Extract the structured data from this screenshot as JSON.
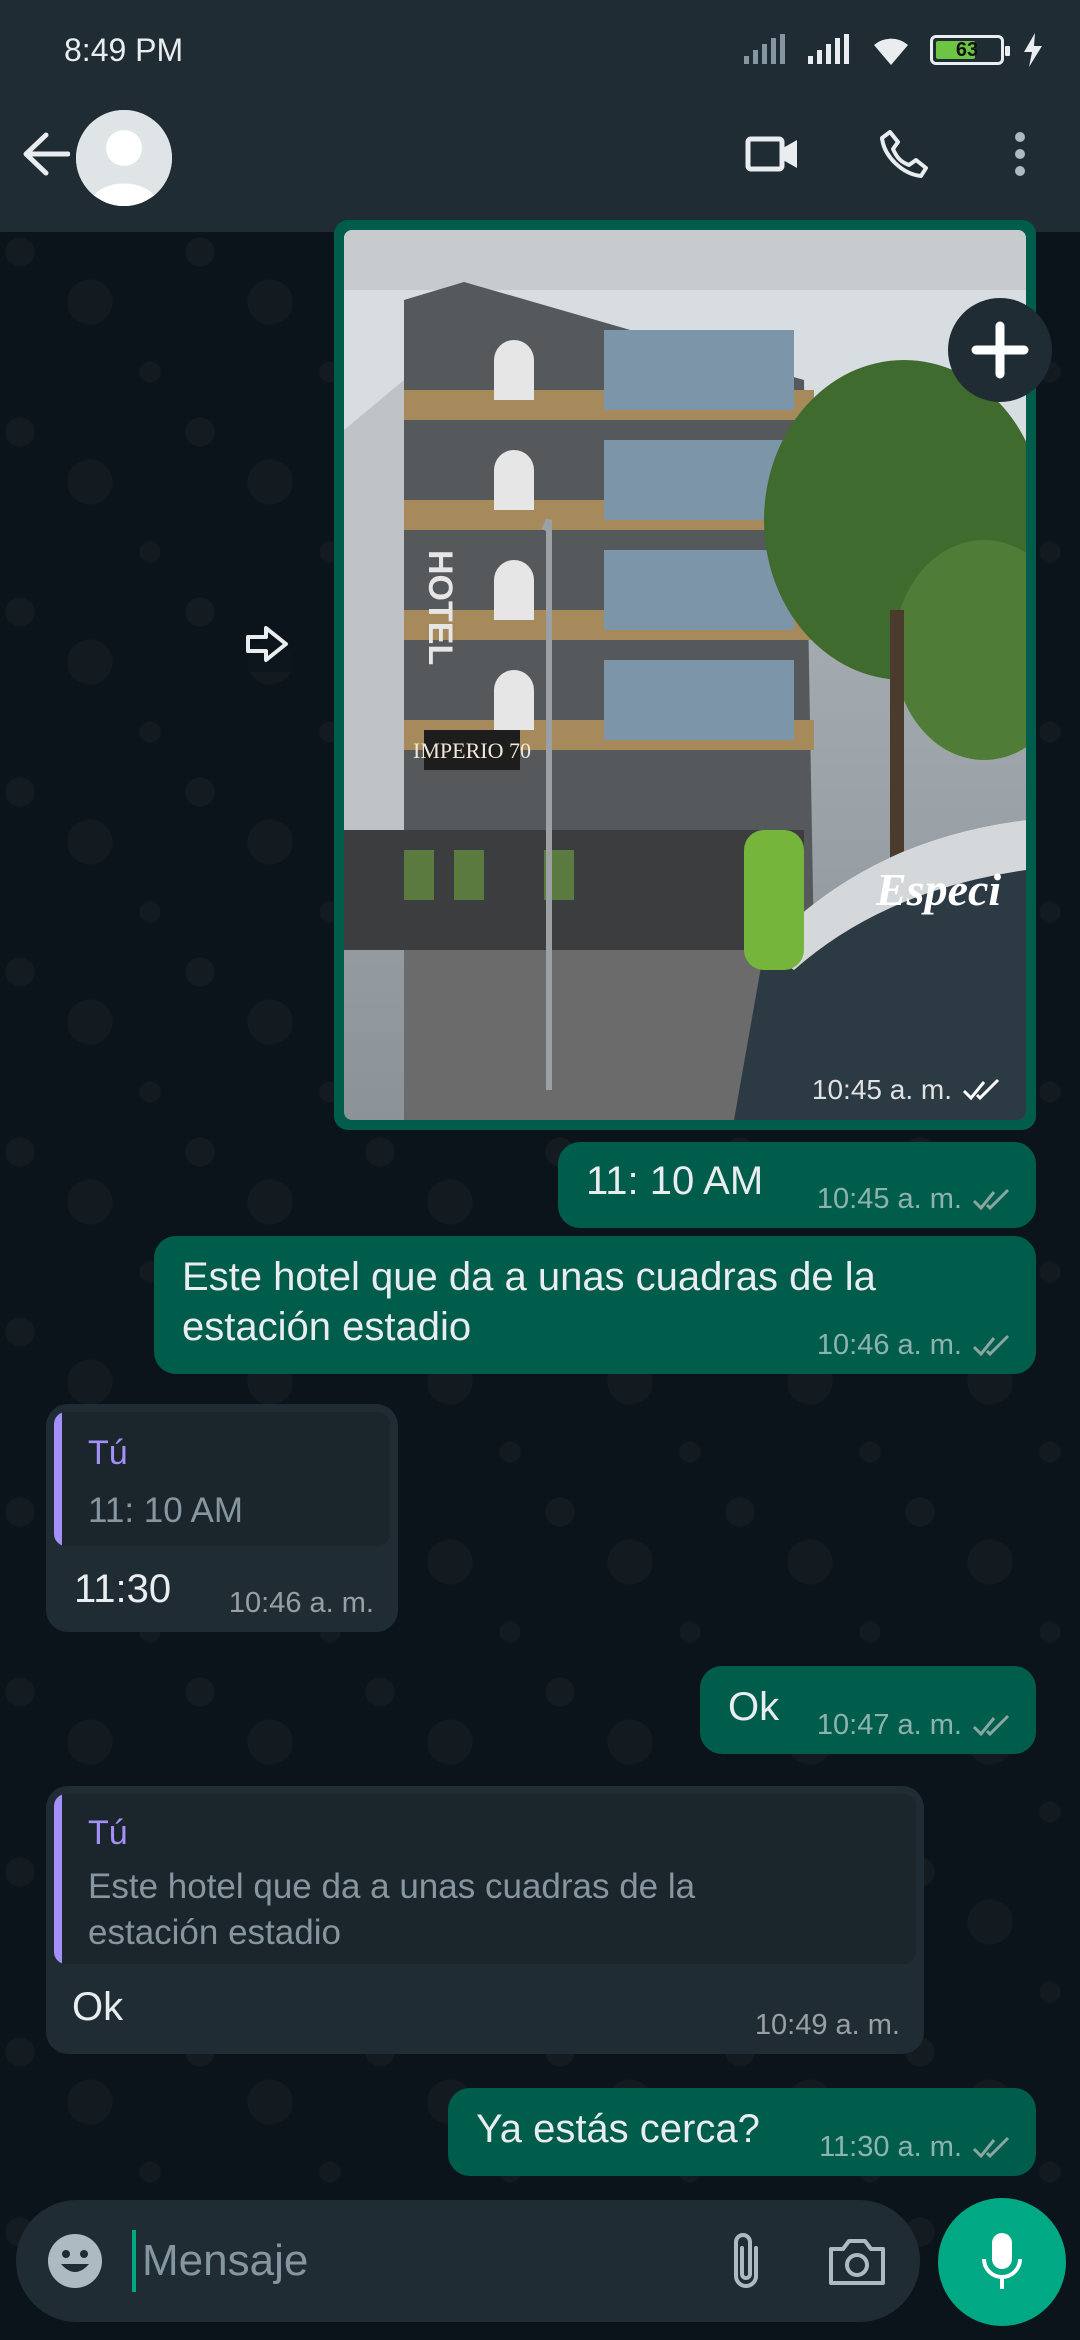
{
  "status_bar": {
    "time": "8:49 PM",
    "battery": "63",
    "battery_level": 0.63
  },
  "header": {
    "contact_avatar": "default-avatar"
  },
  "messages": [
    {
      "type": "image",
      "direction": "out",
      "image_text": [
        "HOTEL",
        "IMPERIO 70",
        "Especi"
      ],
      "time": "10:45 a. m.",
      "status": "read"
    },
    {
      "type": "text",
      "direction": "out",
      "text": "11: 10 AM",
      "time": "10:45 a. m.",
      "status": "read"
    },
    {
      "type": "text",
      "direction": "out",
      "text_lines": [
        "Este hotel que da a unas cuadras de la",
        "estación estadio"
      ],
      "time": "10:46 a. m.",
      "status": "read"
    },
    {
      "type": "reply",
      "direction": "in",
      "quote_author": "Tú",
      "quote_text": "11: 10 AM",
      "text": "11:30",
      "time": "10:46 a. m."
    },
    {
      "type": "text",
      "direction": "out",
      "text": "Ok",
      "time": "10:47 a. m.",
      "status": "read"
    },
    {
      "type": "reply",
      "direction": "in",
      "quote_author": "Tú",
      "quote_lines": [
        "Este hotel que da a unas cuadras de la",
        "estación estadio"
      ],
      "text": "Ok",
      "time": "10:49 a. m."
    },
    {
      "type": "text",
      "direction": "out",
      "text": "Ya estás cerca?",
      "time": "11:30 a. m.",
      "status": "read"
    }
  ],
  "composer": {
    "placeholder": "Mensaje"
  },
  "colors": {
    "outgoing_bubble": "#005c4b",
    "incoming_bubble": "#202c33",
    "accent": "#00a884",
    "quote_author": "#a590fa",
    "header": "#1f2c34",
    "background": "#0b141a"
  }
}
